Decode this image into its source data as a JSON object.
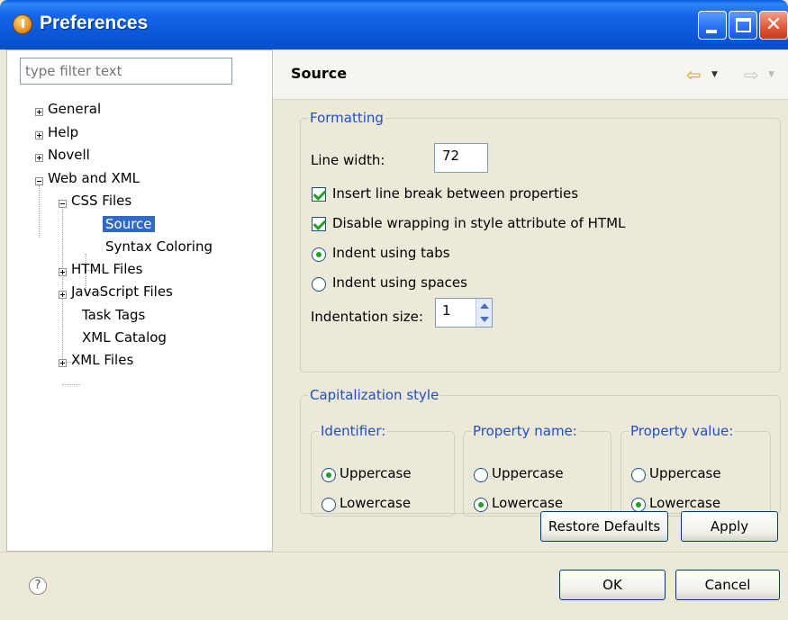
{
  "window": {
    "title": "Preferences"
  },
  "filter": {
    "placeholder": "type filter text"
  },
  "tree": {
    "general": "General",
    "help": "Help",
    "novell": "Novell",
    "web_and_xml": "Web and XML",
    "css_files": "CSS Files",
    "source": "Source",
    "syntax_coloring": "Syntax Coloring",
    "html_files": "HTML Files",
    "javascript_files": "JavaScript Files",
    "task_tags": "Task Tags",
    "xml_catalog": "XML Catalog",
    "xml_files": "XML Files"
  },
  "page": {
    "title": "Source"
  },
  "formatting": {
    "legend": "Formatting",
    "line_width_label": "Line width:",
    "line_width_value": "72",
    "insert_line_break": {
      "label": "Insert line break between properties",
      "checked": true
    },
    "disable_wrapping": {
      "label": "Disable wrapping in style attribute of HTML",
      "checked": true
    },
    "indent_tabs": {
      "label": "Indent using tabs",
      "selected": true
    },
    "indent_spaces": {
      "label": "Indent using spaces",
      "selected": false
    },
    "indentation_size_label": "Indentation size:",
    "indentation_size_value": "1"
  },
  "capitalization": {
    "legend": "Capitalization style",
    "identifier": {
      "legend": "Identifier:",
      "upper": "Uppercase",
      "lower": "Lowercase",
      "selected": "Uppercase"
    },
    "property_name": {
      "legend": "Property name:",
      "upper": "Uppercase",
      "lower": "Lowercase",
      "selected": "Lowercase"
    },
    "property_value": {
      "legend": "Property value:",
      "upper": "Uppercase",
      "lower": "Lowercase",
      "selected": "Lowercase"
    }
  },
  "buttons": {
    "restore_defaults": "Restore Defaults",
    "apply": "Apply",
    "ok": "OK",
    "cancel": "Cancel"
  },
  "icons": {
    "help": "?",
    "back": "⇦",
    "forward": "⇨",
    "dropdown": "▼",
    "close": "✕"
  },
  "colors": {
    "titlebar": "#0b57d8",
    "selection": "#316ac5",
    "legend_text": "#1d4fc8",
    "check_green": "#21a121"
  }
}
